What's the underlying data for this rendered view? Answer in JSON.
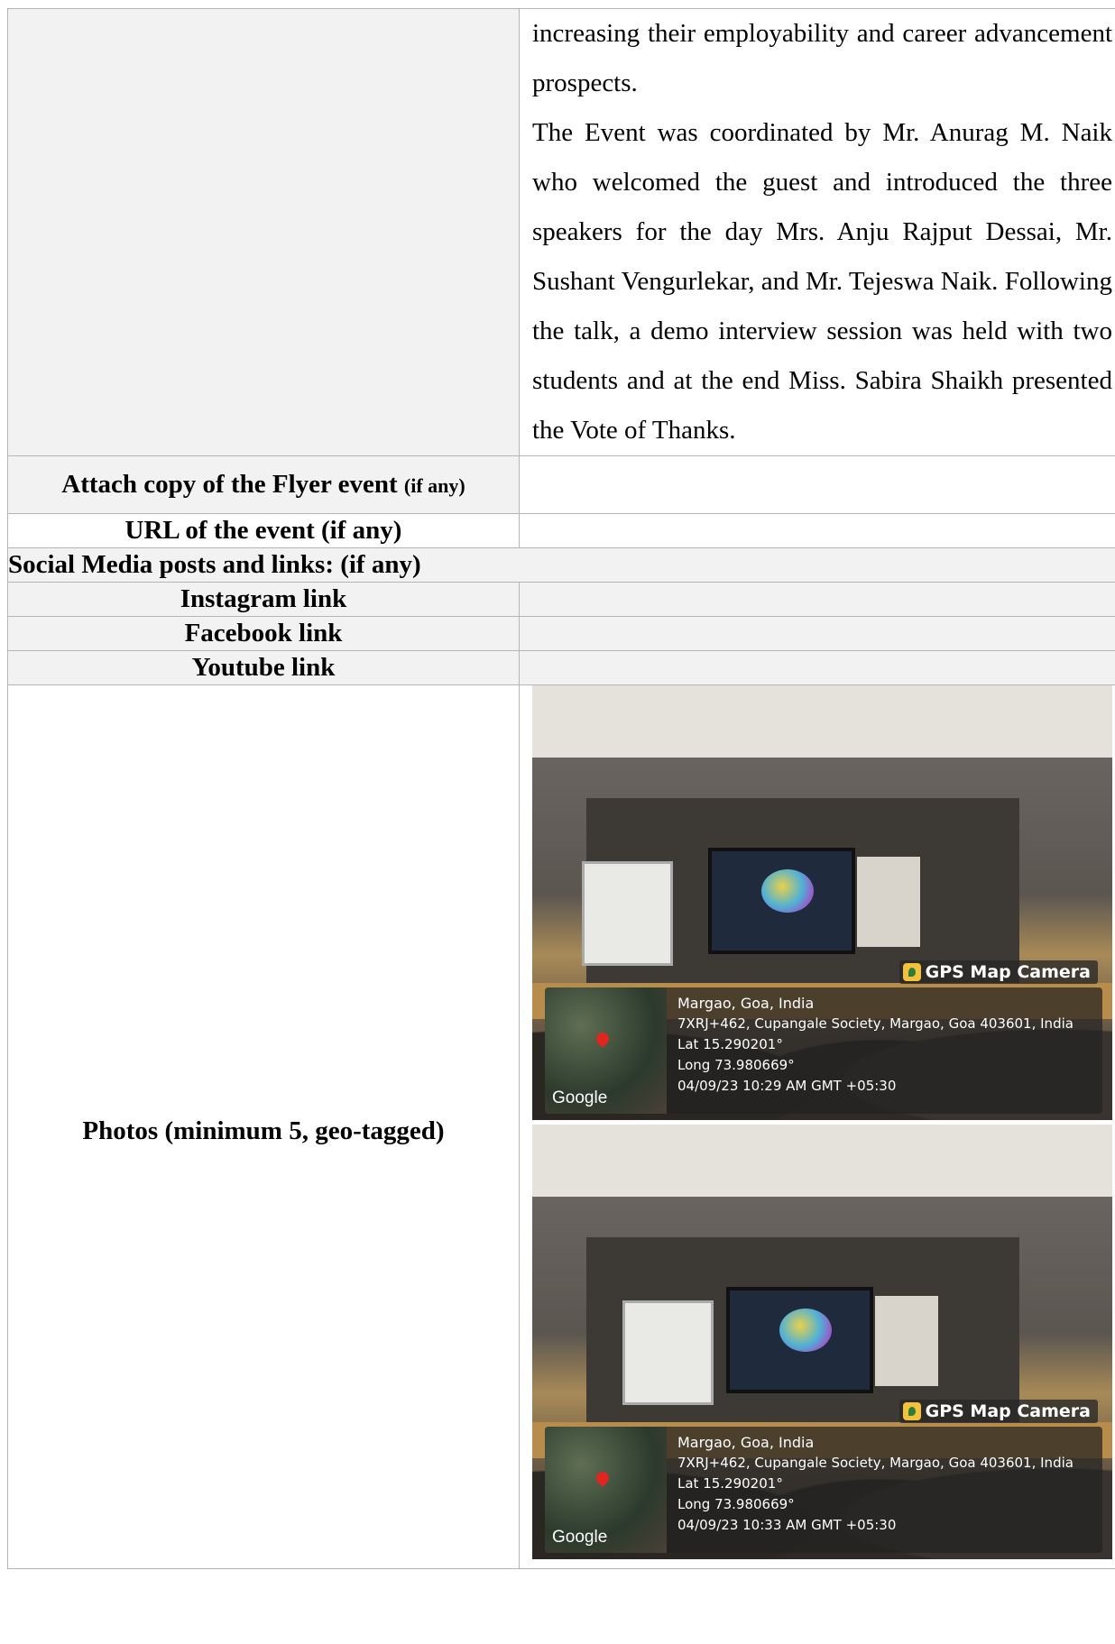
{
  "narrative": {
    "line_top": "increasing their employability and career advancement prospects.",
    "paragraph": "The Event was coordinated by Mr. Anurag M. Naik who welcomed the guest and introduced the three speakers for the day Mrs. Anju Rajput Dessai, Mr. Sushant Vengurlekar, and Mr. Tejeswa Naik. Following the talk, a demo interview session was held with two students and at the end Miss. Sabira Shaikh presented the Vote of Thanks."
  },
  "rows": {
    "flyer_label": "Attach copy of the Flyer event",
    "flyer_suffix": "(if any)",
    "url_label": "URL of the event (if any)",
    "social_header": "Social Media posts and links: (if any)",
    "instagram_label": "Instagram link",
    "facebook_label": "Facebook link",
    "youtube_label": "Youtube link",
    "photos_label": "Photos (minimum 5, geo-tagged)"
  },
  "photos": [
    {
      "badge": "GPS Map Camera",
      "place": "Margao, Goa, India",
      "address": "7XRJ+462, Cupangale Society, Margao, Goa 403601, India",
      "lat": "Lat 15.290201°",
      "long": "Long 73.980669°",
      "timestamp": "04/09/23 10:29 AM GMT +05:30",
      "map_brand": "Google"
    },
    {
      "badge": "GPS Map Camera",
      "place": "Margao, Goa, India",
      "address": "7XRJ+462, Cupangale Society, Margao, Goa 403601, India",
      "lat": "Lat 15.290201°",
      "long": "Long 73.980669°",
      "timestamp": "04/09/23 10:33 AM GMT +05:30",
      "map_brand": "Google"
    }
  ]
}
